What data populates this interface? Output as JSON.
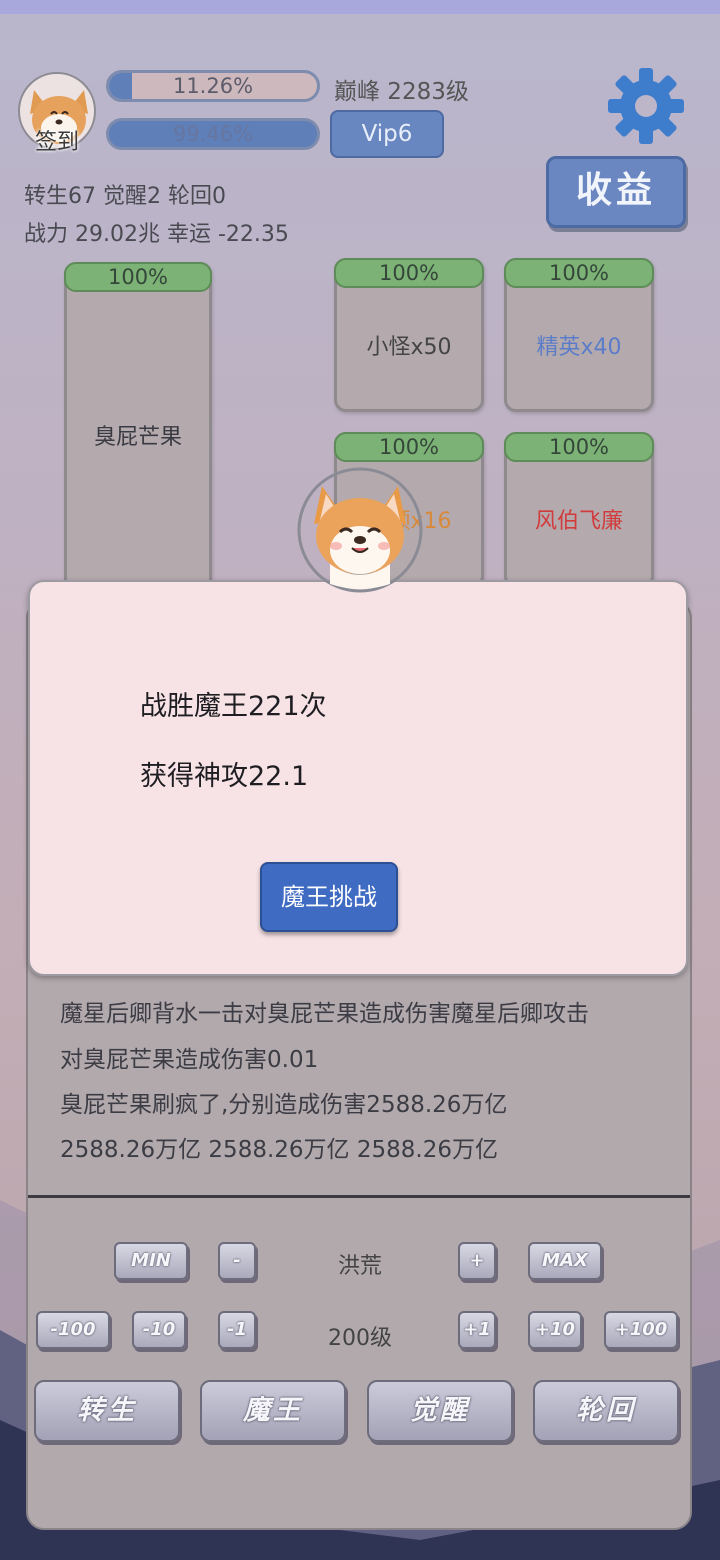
{
  "header": {
    "avatar_label": "签到",
    "exp_bar": {
      "text": "11.26%",
      "fill": 0.1126
    },
    "second_bar": {
      "text": "99.46%",
      "fill": 0.9946
    },
    "level": "巅峰 2283级",
    "vip": "Vip6",
    "income_button": "收益",
    "stats_line1": "转生67 觉醒2 轮回0",
    "stats_line2": "战力 29.02兆  幸运 -22.35"
  },
  "cards": {
    "boss": {
      "hp": "100%",
      "name": "臭屁芒果"
    },
    "minion": {
      "hp": "100%",
      "name": "小怪x50"
    },
    "elite": {
      "hp": "100%",
      "name": "精英x40"
    },
    "leader": {
      "hp": "100%",
      "name": "首领x16"
    },
    "special": {
      "hp": "100%",
      "name": "风伯飞廉"
    }
  },
  "colors": {
    "elite_name": "#5b7cc8",
    "leader_name": "#d8893a",
    "special_name": "#d23b3b",
    "accent_blue": "#3f6bc2"
  },
  "log": {
    "lines": [
      "魔星后卿背水一击对臭屁芒果造成伤害魔星后卿攻击",
      "对臭屁芒果造成伤害0.01",
      "臭屁芒果刷疯了,分别造成伤害2588.26万亿",
      "2588.26万亿 2588.26万亿 2588.26万亿"
    ]
  },
  "controls": {
    "min": "MIN",
    "minus": "-",
    "realm": "洪荒",
    "plus": "+",
    "max": "MAX",
    "minus100": "-100",
    "minus10": "-10",
    "minus1": "-1",
    "level": "200级",
    "plus1": "+1",
    "plus10": "+10",
    "plus100": "+100"
  },
  "actions": {
    "rebirth": "转生",
    "demon_king": "魔王",
    "awaken": "觉醒",
    "reincarnate": "轮回"
  },
  "dialog": {
    "line1": "战胜魔王221次",
    "line2": "获得神攻22.1",
    "button": "魔王挑战"
  }
}
